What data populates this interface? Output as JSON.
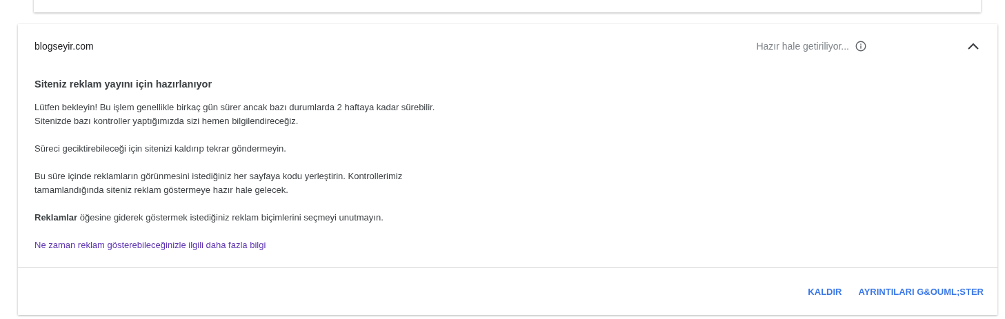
{
  "site_card": {
    "site": "blogseyir.com",
    "status": "Hazır hale getiriliyor...",
    "expanded": true,
    "heading": "Siteniz reklam yayını için hazırlanıyor",
    "paragraphs": [
      {
        "lines": [
          "Lütfen bekleyin! Bu işlem genellikle birkaç gün sürer ancak bazı durumlarda 2 haftaya kadar sürebilir.",
          "Sitenizde bazı kontroller yaptığımızda sizi hemen bilgilendireceğiz."
        ]
      },
      {
        "lines": [
          "Süreci geciktirebileceği için sitenizi kaldırıp tekrar göndermeyin."
        ]
      },
      {
        "lines": [
          "Bu süre içinde reklamların görünmesini istediğiniz her sayfaya kodu yerleştirin. Kontrollerimiz",
          "tamamlandığında siteniz reklam göstermeye hazır hale gelecek."
        ]
      },
      {
        "lines": [
          "**Reklamlar** öğesine giderek göstermek istediğiniz reklam biçimlerini seçmeyi unutmayın."
        ]
      }
    ],
    "link": "Ne zaman reklam gösterebileceğinizle ilgili daha fazla bilgi",
    "buttons": [
      "KALDIR",
      "AYRINTILARI G&OUML;STER"
    ]
  }
}
